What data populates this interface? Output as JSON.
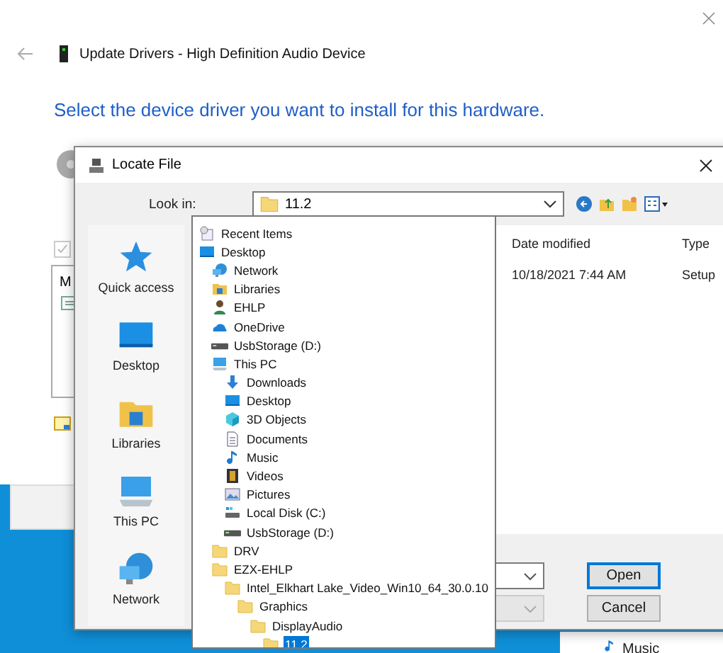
{
  "wizard": {
    "title": "Update Drivers - High Definition Audio Device",
    "heading": "Select the device driver you want to install for this hardware.",
    "checkbox": {
      "checked": true,
      "disabled": true
    },
    "list_header": "M"
  },
  "dialog": {
    "title": "Locate File",
    "look_in_label": "Look in:",
    "look_in_value": "11.2",
    "places": [
      {
        "label": "Quick access",
        "kind": "star",
        "selected": false
      },
      {
        "label": "Desktop",
        "kind": "monitor",
        "selected": false
      },
      {
        "label": "Libraries",
        "kind": "library",
        "selected": false
      },
      {
        "label": "This PC",
        "kind": "computer",
        "selected": false
      },
      {
        "label": "Network",
        "kind": "network",
        "selected": false
      }
    ],
    "columns": [
      "Date modified",
      "Type"
    ],
    "rows": [
      {
        "date_modified": "10/18/2021 7:44 AM",
        "type": "Setup"
      }
    ],
    "buttons": [
      {
        "label": "Open",
        "focused": true
      },
      {
        "label": "Cancel",
        "focused": false
      }
    ],
    "look_in_dropdown": [
      {
        "label": "Recent Items",
        "kind": "recent",
        "selected": false
      },
      {
        "label": "Desktop",
        "kind": "monitor",
        "selected": false,
        "children": [
          {
            "label": "Network",
            "kind": "network",
            "selected": false
          },
          {
            "label": "Libraries",
            "kind": "library",
            "selected": false
          },
          {
            "label": "EHLP",
            "kind": "user",
            "selected": false
          },
          {
            "label": "OneDrive",
            "kind": "cloud",
            "selected": false
          },
          {
            "label": "UsbStorage (D:)",
            "kind": "drive",
            "selected": false
          },
          {
            "label": "This PC",
            "kind": "computer",
            "selected": false,
            "children": [
              {
                "label": "Downloads",
                "kind": "downloads",
                "selected": false
              },
              {
                "label": "Desktop",
                "kind": "monitor",
                "selected": false
              },
              {
                "label": "3D Objects",
                "kind": "cube",
                "selected": false
              },
              {
                "label": "Documents",
                "kind": "document",
                "selected": false
              },
              {
                "label": "Music",
                "kind": "music",
                "selected": false
              },
              {
                "label": "Videos",
                "kind": "film",
                "selected": false
              },
              {
                "label": "Pictures",
                "kind": "picture",
                "selected": false
              },
              {
                "label": "Local Disk (C:)",
                "kind": "disk",
                "selected": false
              },
              {
                "label": "UsbStorage (D:)",
                "kind": "drive",
                "selected": false
              }
            ]
          },
          {
            "label": "DRV",
            "kind": "folder",
            "selected": false
          },
          {
            "label": "EZX-EHLP",
            "kind": "folder",
            "selected": false,
            "children": [
              {
                "label": "Intel_Elkhart Lake_Video_Win10_64_30.0.10",
                "kind": "folder",
                "selected": false,
                "children": [
                  {
                    "label": "Graphics",
                    "kind": "folder",
                    "selected": false,
                    "children": [
                      {
                        "label": "DisplayAudio",
                        "kind": "folder",
                        "selected": false,
                        "children": [
                          {
                            "label": "11.2",
                            "kind": "folder",
                            "selected": true
                          }
                        ]
                      }
                    ]
                  }
                ]
              }
            ]
          }
        ]
      }
    ]
  },
  "background_panel": {
    "label": "Music"
  }
}
